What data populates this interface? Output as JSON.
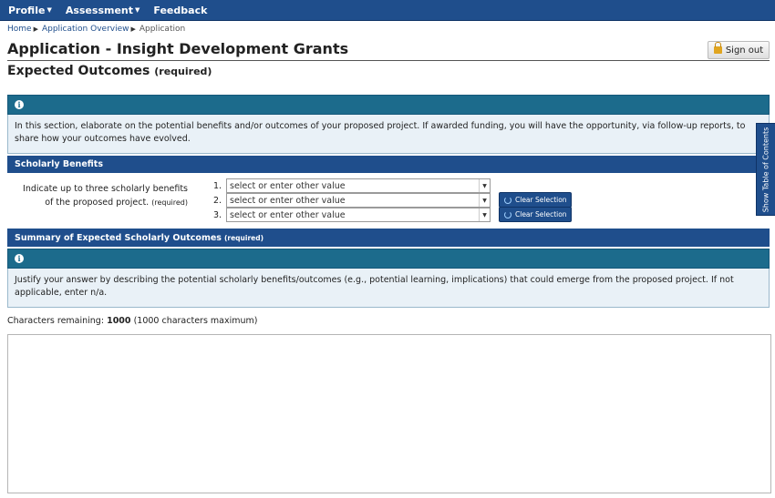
{
  "nav": {
    "items": [
      {
        "label": "Profile",
        "has_menu": true
      },
      {
        "label": "Assessment",
        "has_menu": true
      },
      {
        "label": "Feedback",
        "has_menu": false
      }
    ]
  },
  "breadcrumb": {
    "home": "Home",
    "overview": "Application Overview",
    "current": "Application",
    "separator": "▶"
  },
  "header": {
    "title": "Application - Insight Development Grants",
    "signout_label": "Sign out"
  },
  "section": {
    "title": "Expected Outcomes",
    "required_label": "(required)"
  },
  "info1": {
    "icon": "info-icon",
    "text": "In this section, elaborate on the potential benefits and/or outcomes of your proposed project. If awarded funding, you will have the opportunity, via follow-up reports, to share how your outcomes have evolved."
  },
  "scholarly": {
    "band_title": "Scholarly Benefits",
    "label": "Indicate up to three scholarly benefits of the proposed project.",
    "required_label": "(required)",
    "selects": [
      {
        "number": "1.",
        "value": "select or enter other value"
      },
      {
        "number": "2.",
        "value": "select or enter other value"
      },
      {
        "number": "3.",
        "value": "select or enter other value"
      }
    ],
    "clear_label": "Clear Selection"
  },
  "summary": {
    "band_title": "Summary of Expected Scholarly Outcomes",
    "required_label": "(required)",
    "info_text": "Justify your answer by describing the potential scholarly benefits/outcomes (e.g., potential learning, implications) that could emerge from the proposed project. If not applicable, enter n/a.",
    "chars_prefix": "Characters remaining:",
    "chars_value": "1000",
    "chars_suffix": "(1000 characters maximum)"
  },
  "toc": {
    "label": "Show Table of Contents"
  },
  "colors": {
    "nav": "#1f4e8c",
    "info_header": "#1c6b8c",
    "info_bg": "#e9f1f7"
  }
}
